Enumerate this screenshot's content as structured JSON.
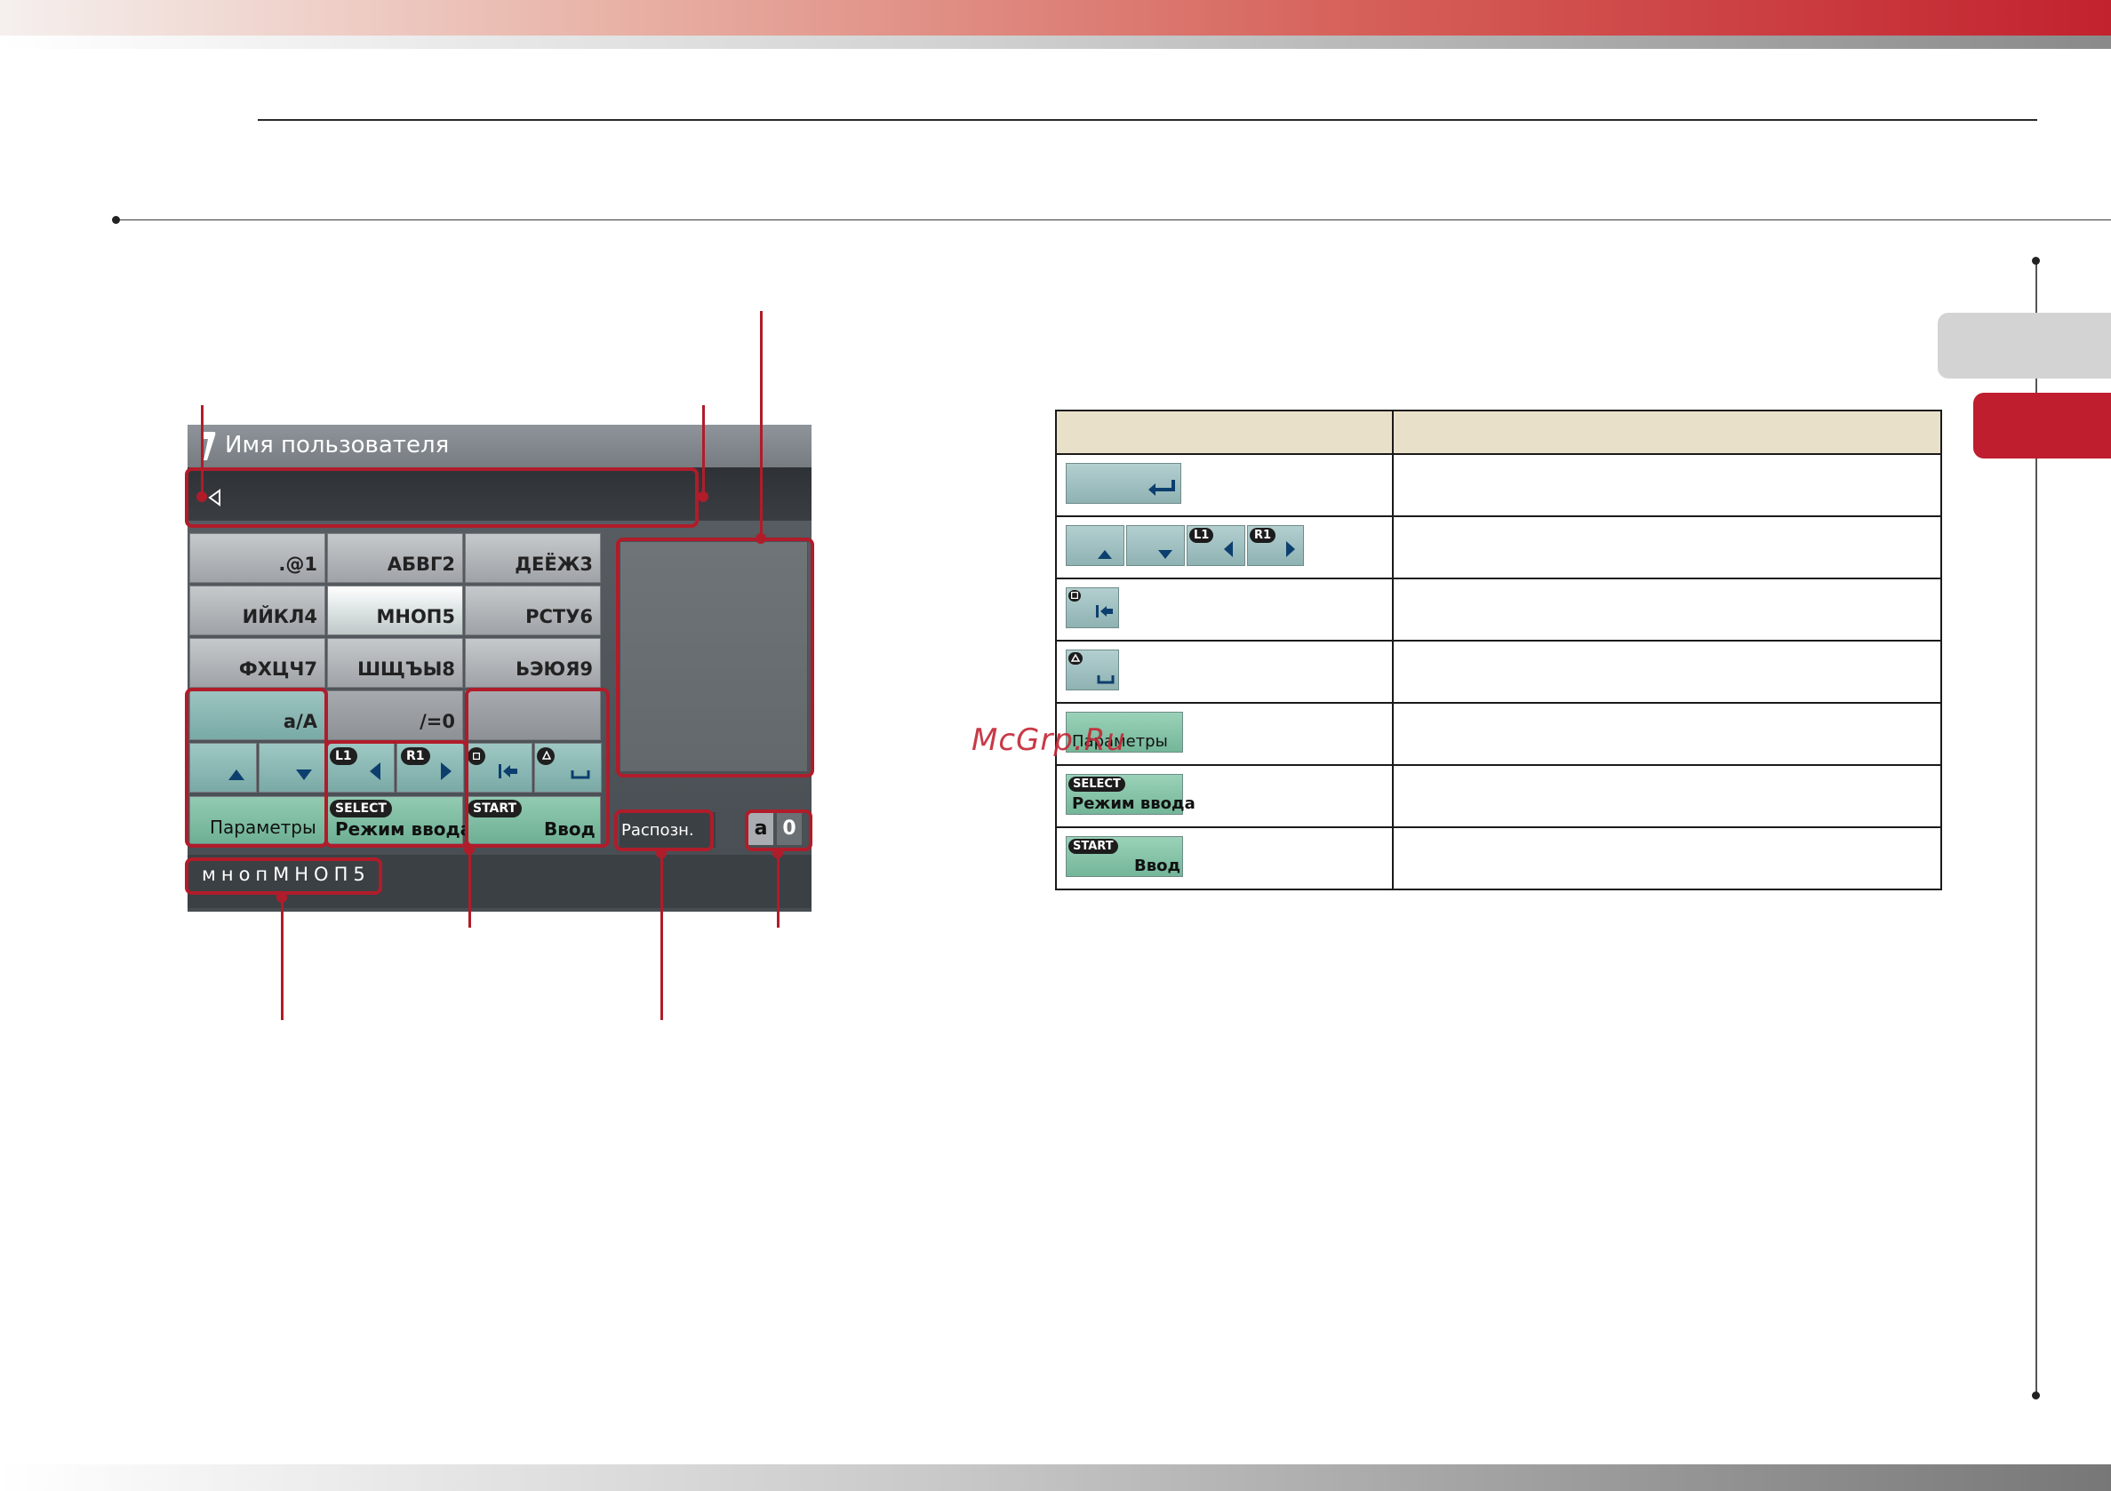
{
  "psp": {
    "title": "Имя пользователя",
    "keys": [
      [
        ".@1",
        "АБВГ2",
        "ДЕЁЖ3"
      ],
      [
        "ИЙКЛ4",
        "МНОП5",
        "РСТУ6"
      ],
      [
        "ФХЦЧ7",
        "ШЩЪЫ8",
        "ЬЭЮЯ9"
      ]
    ],
    "key_case": "a/A",
    "key_symbol": "/=0",
    "badges": {
      "l1": "L1",
      "r1": "R1",
      "select": "SELECT",
      "start": "START"
    },
    "options_label": "Параметры",
    "input_mode_label": "Режим ввода",
    "enter_label": "Ввод",
    "recognize_label": "Распозн.",
    "mode_letter": "a",
    "mode_digit": "0",
    "prediction": "мнопМНОП5"
  },
  "table": {
    "headers": [
      "",
      ""
    ],
    "rows": [
      {
        "button": "enter",
        "description": ""
      },
      {
        "button": "arrows",
        "description": ""
      },
      {
        "button": "backspace",
        "description": ""
      },
      {
        "button": "space",
        "description": ""
      },
      {
        "button": "options",
        "description": ""
      },
      {
        "button": "input_mode",
        "description": ""
      },
      {
        "button": "enter_start",
        "description": ""
      }
    ],
    "options_label": "Параметры",
    "input_mode_label": "Режим ввода",
    "enter_label": "Ввод",
    "badges": {
      "l1": "L1",
      "r1": "R1",
      "select": "SELECT",
      "start": "START"
    }
  },
  "watermark": "McGrp.Ru",
  "colors": {
    "accent_red": "#b01c2a",
    "brand_red": "#be1e2d",
    "header_beige": "#e8e0c8"
  },
  "icons": [
    "user-icon",
    "cursor-icon",
    "up-arrow-icon",
    "down-arrow-icon",
    "left-arrow-icon",
    "right-arrow-icon",
    "square-icon",
    "triangle-icon",
    "backspace-icon",
    "space-icon",
    "enter-icon"
  ]
}
